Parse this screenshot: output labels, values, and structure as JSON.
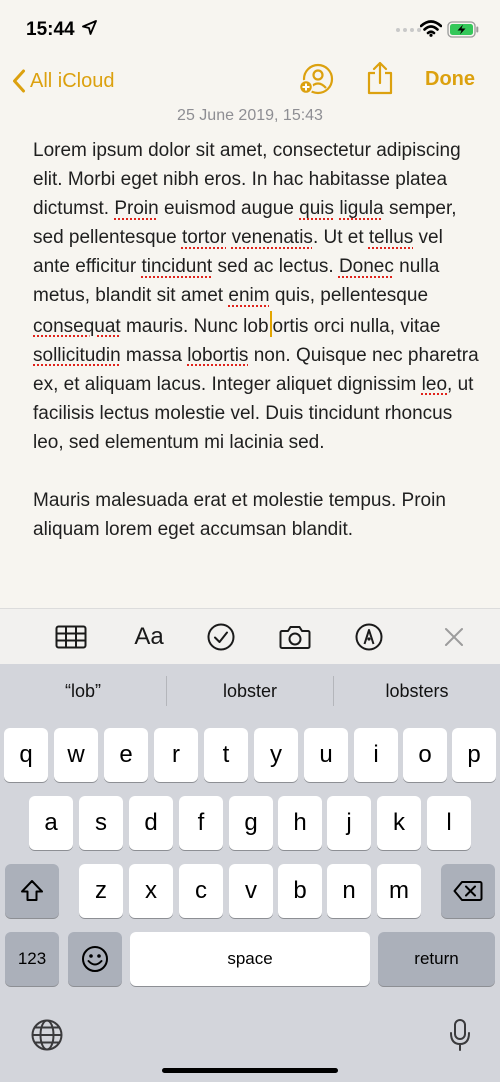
{
  "status_bar": {
    "time": "15:44"
  },
  "nav": {
    "back_label": "All iCloud",
    "done_label": "Done"
  },
  "note": {
    "date": "25 June 2019, 15:43",
    "paragraph1": [
      {
        "t": "Lorem ipsum dolor sit amet, consectetur adipiscing elit. Morbi eget nibh eros. In hac habitasse platea dictumst. "
      },
      {
        "t": "Proin",
        "s": true
      },
      {
        "t": " euismod augue "
      },
      {
        "t": "quis",
        "s": true
      },
      {
        "t": " "
      },
      {
        "t": "ligula",
        "s": true
      },
      {
        "t": " semper, sed pellentesque "
      },
      {
        "t": "tortor",
        "s": true
      },
      {
        "t": " "
      },
      {
        "t": "venenatis",
        "s": true
      },
      {
        "t": ". Ut et "
      },
      {
        "t": "tellus",
        "s": true
      },
      {
        "t": " vel ante efficitur "
      },
      {
        "t": "tincidunt",
        "s": true
      },
      {
        "t": " sed ac lectus. "
      },
      {
        "t": "Donec",
        "s": true
      },
      {
        "t": " nulla metus, blandit sit amet "
      },
      {
        "t": "enim",
        "s": true
      },
      {
        "t": " quis, pellentesque "
      },
      {
        "t": "consequat",
        "s": true
      },
      {
        "t": " mauris. Nunc lob"
      },
      {
        "caret": true
      },
      {
        "t": "ortis orci nulla, vitae "
      },
      {
        "t": "sollicitudin",
        "s": true
      },
      {
        "t": " massa "
      },
      {
        "t": "lobortis",
        "s": true
      },
      {
        "t": " non. Quisque nec pharetra ex, et aliquam lacus. Integer aliquet dignissim "
      },
      {
        "t": "leo",
        "s": true
      },
      {
        "t": ", ut facilisis lectus molestie vel. Duis tincidunt rhoncus leo, sed elementum mi lacinia sed."
      }
    ],
    "paragraph2": "Mauris malesuada erat et molestie tempus. Proin aliquam lorem eget accumsan blandit."
  },
  "keyboard": {
    "predictions": [
      "“lob”",
      "lobster",
      "lobsters"
    ],
    "row1": [
      "q",
      "w",
      "e",
      "r",
      "t",
      "y",
      "u",
      "i",
      "o",
      "p"
    ],
    "row2": [
      "a",
      "s",
      "d",
      "f",
      "g",
      "h",
      "j",
      "k",
      "l"
    ],
    "row3": [
      "z",
      "x",
      "c",
      "v",
      "b",
      "n",
      "m"
    ],
    "numbers_label": "123",
    "space_label": "space",
    "return_label": "return"
  },
  "colors": {
    "accent": "#dca10f",
    "spell_underline": "#e0231b"
  },
  "icons": [
    "location-arrow-icon",
    "wifi-icon",
    "battery-charging-icon",
    "chevron-left-icon",
    "add-people-icon",
    "share-icon",
    "table-icon",
    "checklist-icon",
    "camera-icon",
    "markup-icon",
    "close-icon",
    "shift-icon",
    "delete-icon",
    "emoji-icon",
    "globe-icon",
    "microphone-icon"
  ]
}
